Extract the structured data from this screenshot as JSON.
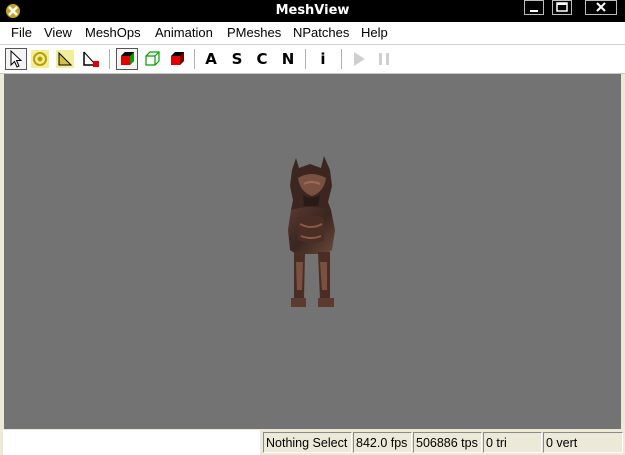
{
  "window": {
    "title": "MeshView"
  },
  "menu": [
    "File",
    "View",
    "MeshOps",
    "Animation",
    "PMeshes",
    "NPatches",
    "Help"
  ],
  "toolbar": {
    "letters": [
      "A",
      "S",
      "C",
      "N"
    ],
    "info": "i",
    "icons": [
      "select-arrow-icon",
      "rotate-icon",
      "scale-icon",
      "translate-icon",
      "solid-cube-icon",
      "wireframe-cube-icon",
      "shaded-cube-icon",
      "play-icon",
      "pause-icon"
    ]
  },
  "status": {
    "selection": "Nothing Select",
    "fps": "842.0 fps",
    "tps": "506886 tps",
    "tri": "0 tri",
    "vert": "0 vert"
  },
  "colors": {
    "viewport": "#737373",
    "titlebar": "#000000",
    "chrome": "#ece9d8"
  }
}
